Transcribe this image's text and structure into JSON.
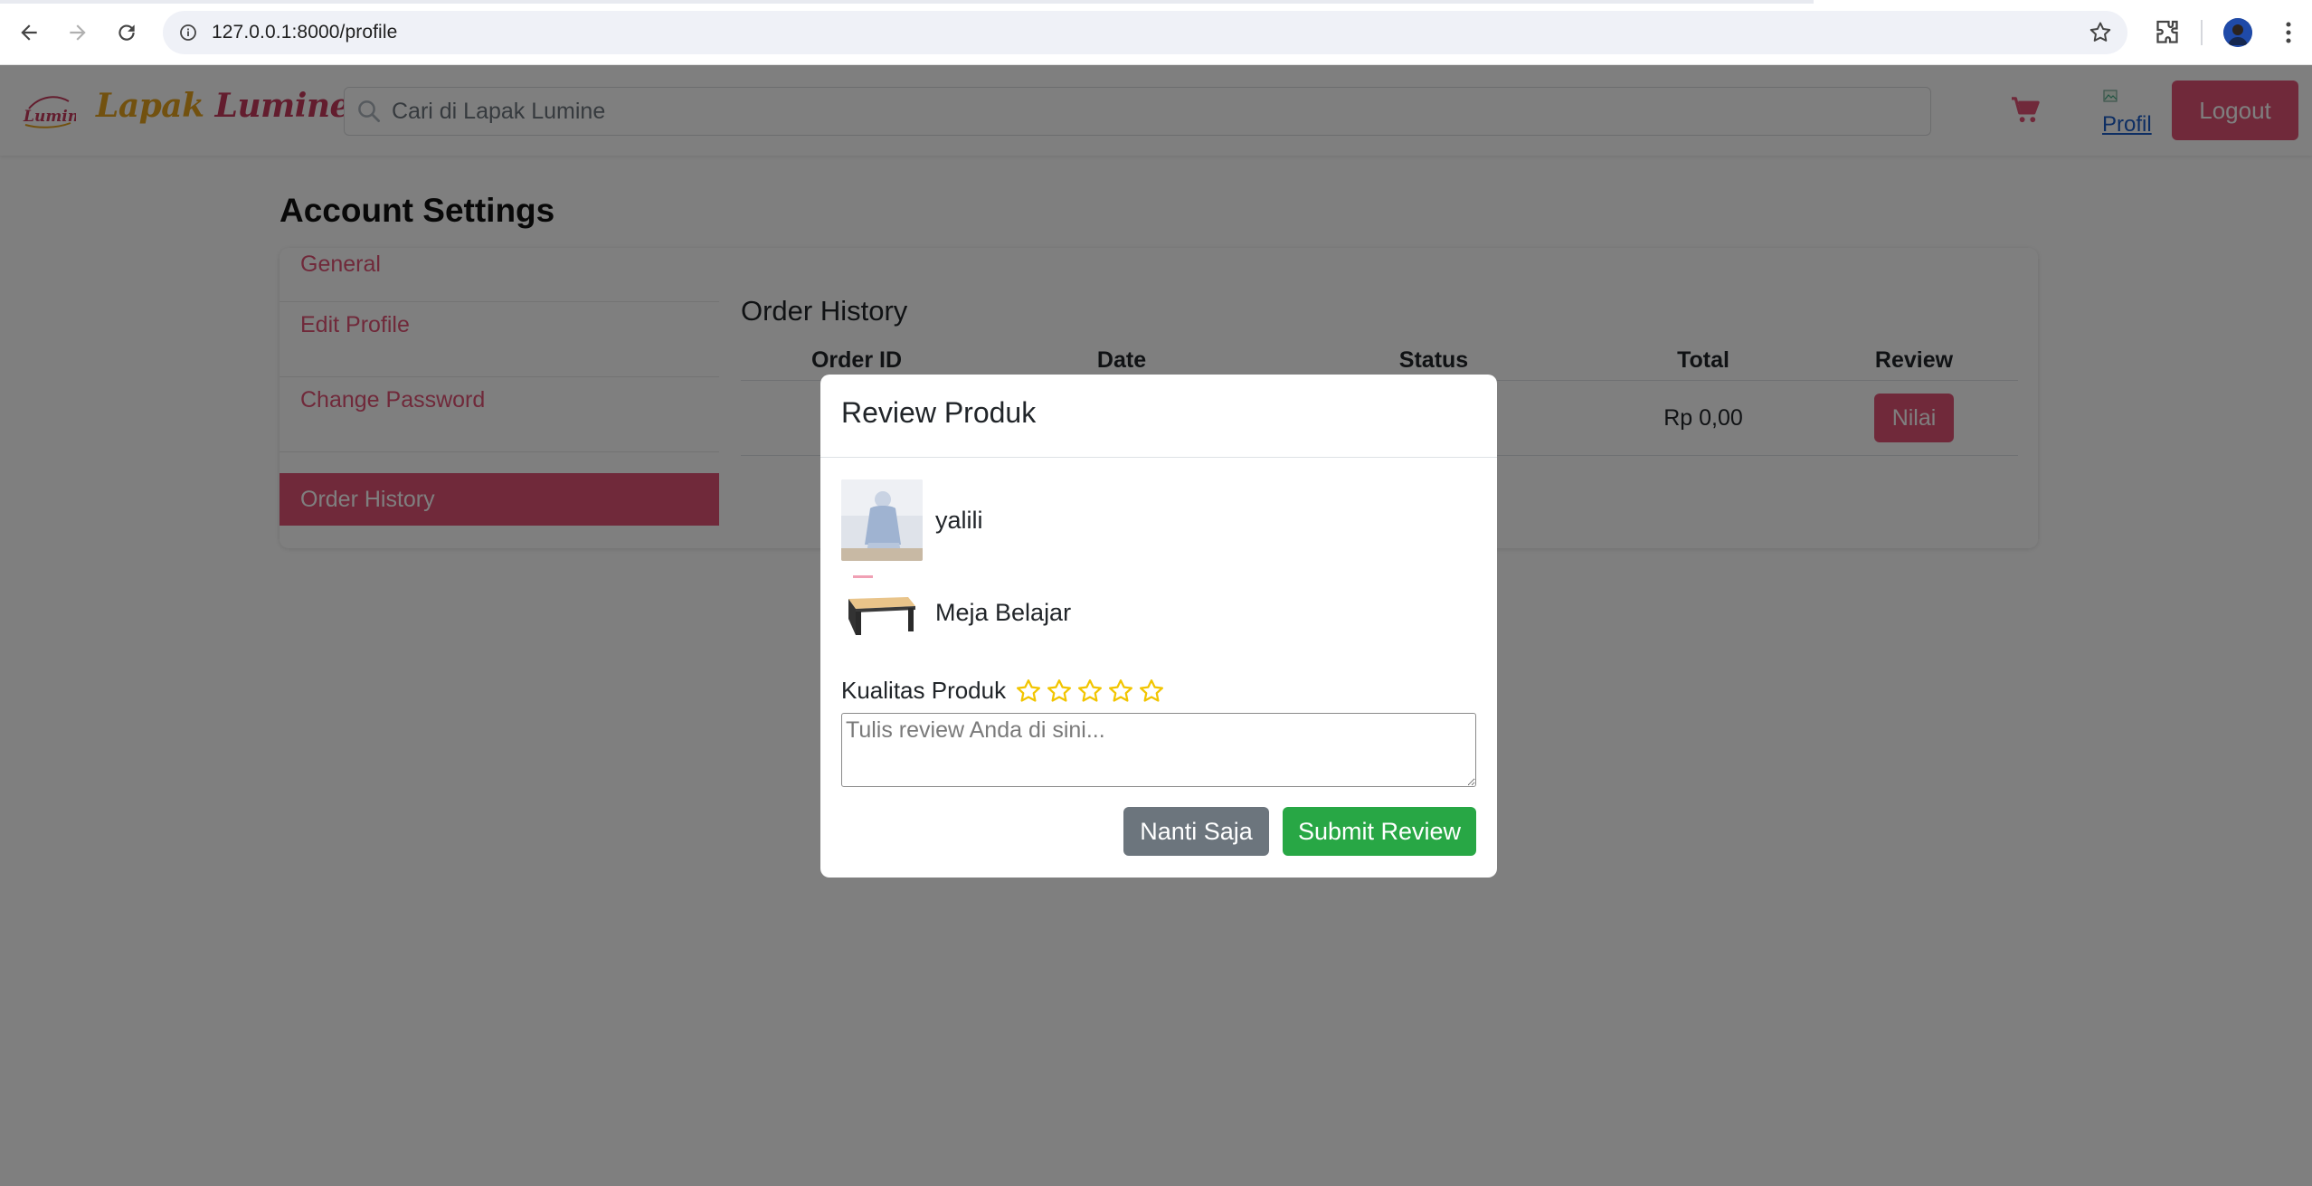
{
  "browser": {
    "url": "127.0.0.1:8000/profile"
  },
  "navbar": {
    "brand_part1": "Lapak ",
    "brand_part2": "Lumine",
    "logo_text": "Lumine",
    "search_placeholder": "Cari di Lapak Lumine",
    "profile_alt": "Profil",
    "logout_label": "Logout"
  },
  "page": {
    "title": "Account Settings",
    "sidebar": {
      "items": [
        {
          "label": "General"
        },
        {
          "label": "Edit Profile"
        },
        {
          "label": "Change Password"
        },
        {
          "label": "Order History"
        }
      ],
      "active": "Order History"
    },
    "orders": {
      "heading": "Order History",
      "columns": [
        "Order ID",
        "Date",
        "Status",
        "Total",
        "Review"
      ],
      "rows": [
        {
          "total": "Rp 0,00",
          "review_button": "Nilai"
        }
      ]
    }
  },
  "modal": {
    "title": "Review Produk",
    "products": [
      {
        "name": "yalili"
      },
      {
        "name": "Meja Belajar"
      }
    ],
    "rating_label": "Kualitas Produk",
    "stars": 5,
    "rating_value": 0,
    "review_placeholder": "Tulis review Anda di sini...",
    "later_label": "Nanti Saja",
    "submit_label": "Submit Review"
  },
  "colors": {
    "accent": "#e05275",
    "success": "#28a745",
    "secondary": "#6c757d",
    "star": "#f2c500"
  }
}
